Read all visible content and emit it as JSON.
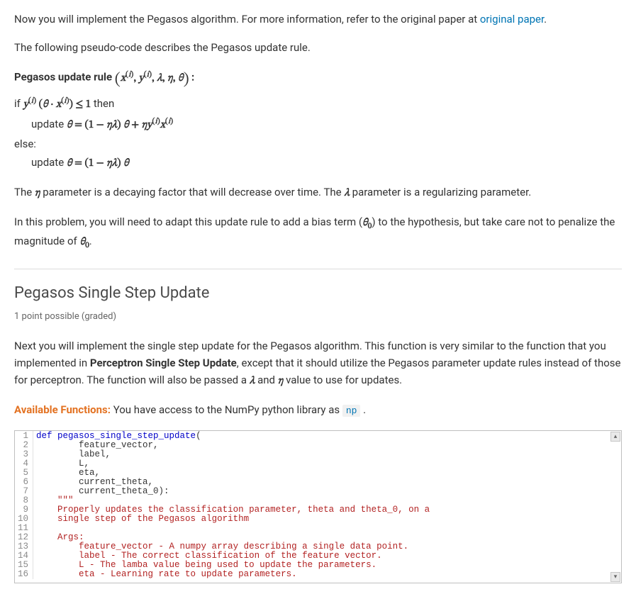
{
  "intro": {
    "p1_a": "Now you will implement the Pegasos algorithm. For more information, refer to the original paper at ",
    "link_text": "original paper",
    "p1_b": ".",
    "p2": "The following pseudo-code describes the Pegasos update rule."
  },
  "rule": {
    "title_lead": "Pegasos update rule",
    "title_args": "x(i), y(i), λ, η, θ",
    "title_colon": " :",
    "if_lead": "if ",
    "if_cond": "y(i) (θ · x(i)) ≤ 1",
    "if_tail": " then",
    "update_a_lead": "update ",
    "update_a_body": "θ = (1 − ηλ) θ + ηy(i)x(i)",
    "else": "else:",
    "update_b_lead": "update ",
    "update_b_body": "θ = (1 − ηλ) θ"
  },
  "explain": {
    "p3_a": "The ",
    "p3_b": " parameter is a decaying factor that will decrease over time. The ",
    "p3_c": " parameter is a regularizing parameter.",
    "p4_a": "In this problem, you will need to adapt this update rule to add a bias term (",
    "p4_b": ") to the hypothesis, but take care not to penalize the magnitude of ",
    "p4_c": ".",
    "eta": "η",
    "lambda": "λ",
    "theta0": "θ0"
  },
  "section": {
    "title": "Pegasos Single Step Update",
    "points": "1 point possible (graded)",
    "p5_a": "Next you will implement the single step update for the Pegasos algorithm. This function is very similar to the function that you implemented in ",
    "p5_b": "Perceptron Single Step Update",
    "p5_c": ", except that it should utilize the Pegasos parameter update rules instead of those for perceptron. The function will also be passed a ",
    "p5_d": " and ",
    "p5_e": " value to use for updates.",
    "avail_label": "Available Functions:",
    "avail_text": " You have access to the NumPy python library as ",
    "np_code": "np",
    "avail_tail": " ."
  },
  "code": {
    "lines": [
      {
        "n": 1,
        "kw": "def ",
        "fn": "pegasos_single_step_update",
        "rest": "("
      },
      {
        "n": 2,
        "indent": "        ",
        "text": "feature_vector,"
      },
      {
        "n": 3,
        "indent": "        ",
        "text": "label,"
      },
      {
        "n": 4,
        "indent": "        ",
        "text": "L,"
      },
      {
        "n": 5,
        "indent": "        ",
        "text": "eta,"
      },
      {
        "n": 6,
        "indent": "        ",
        "text": "current_theta,"
      },
      {
        "n": 7,
        "indent": "        ",
        "text": "current_theta_0):"
      },
      {
        "n": 8,
        "indent": "    ",
        "str": "\"\"\""
      },
      {
        "n": 9,
        "indent": "    ",
        "str": "Properly updates the classification parameter, theta and theta_0, on a"
      },
      {
        "n": 10,
        "indent": "    ",
        "str": "single step of the Pegasos algorithm"
      },
      {
        "n": 11,
        "indent": "",
        "str": ""
      },
      {
        "n": 12,
        "indent": "    ",
        "str": "Args:"
      },
      {
        "n": 13,
        "indent": "        ",
        "str": "feature_vector - A numpy array describing a single data point."
      },
      {
        "n": 14,
        "indent": "        ",
        "str": "label - The correct classification of the feature vector."
      },
      {
        "n": 15,
        "indent": "        ",
        "str": "L - The lamba value being used to update the parameters."
      },
      {
        "n": 16,
        "indent": "        ",
        "str": "eta - Learning rate to update parameters."
      }
    ]
  }
}
